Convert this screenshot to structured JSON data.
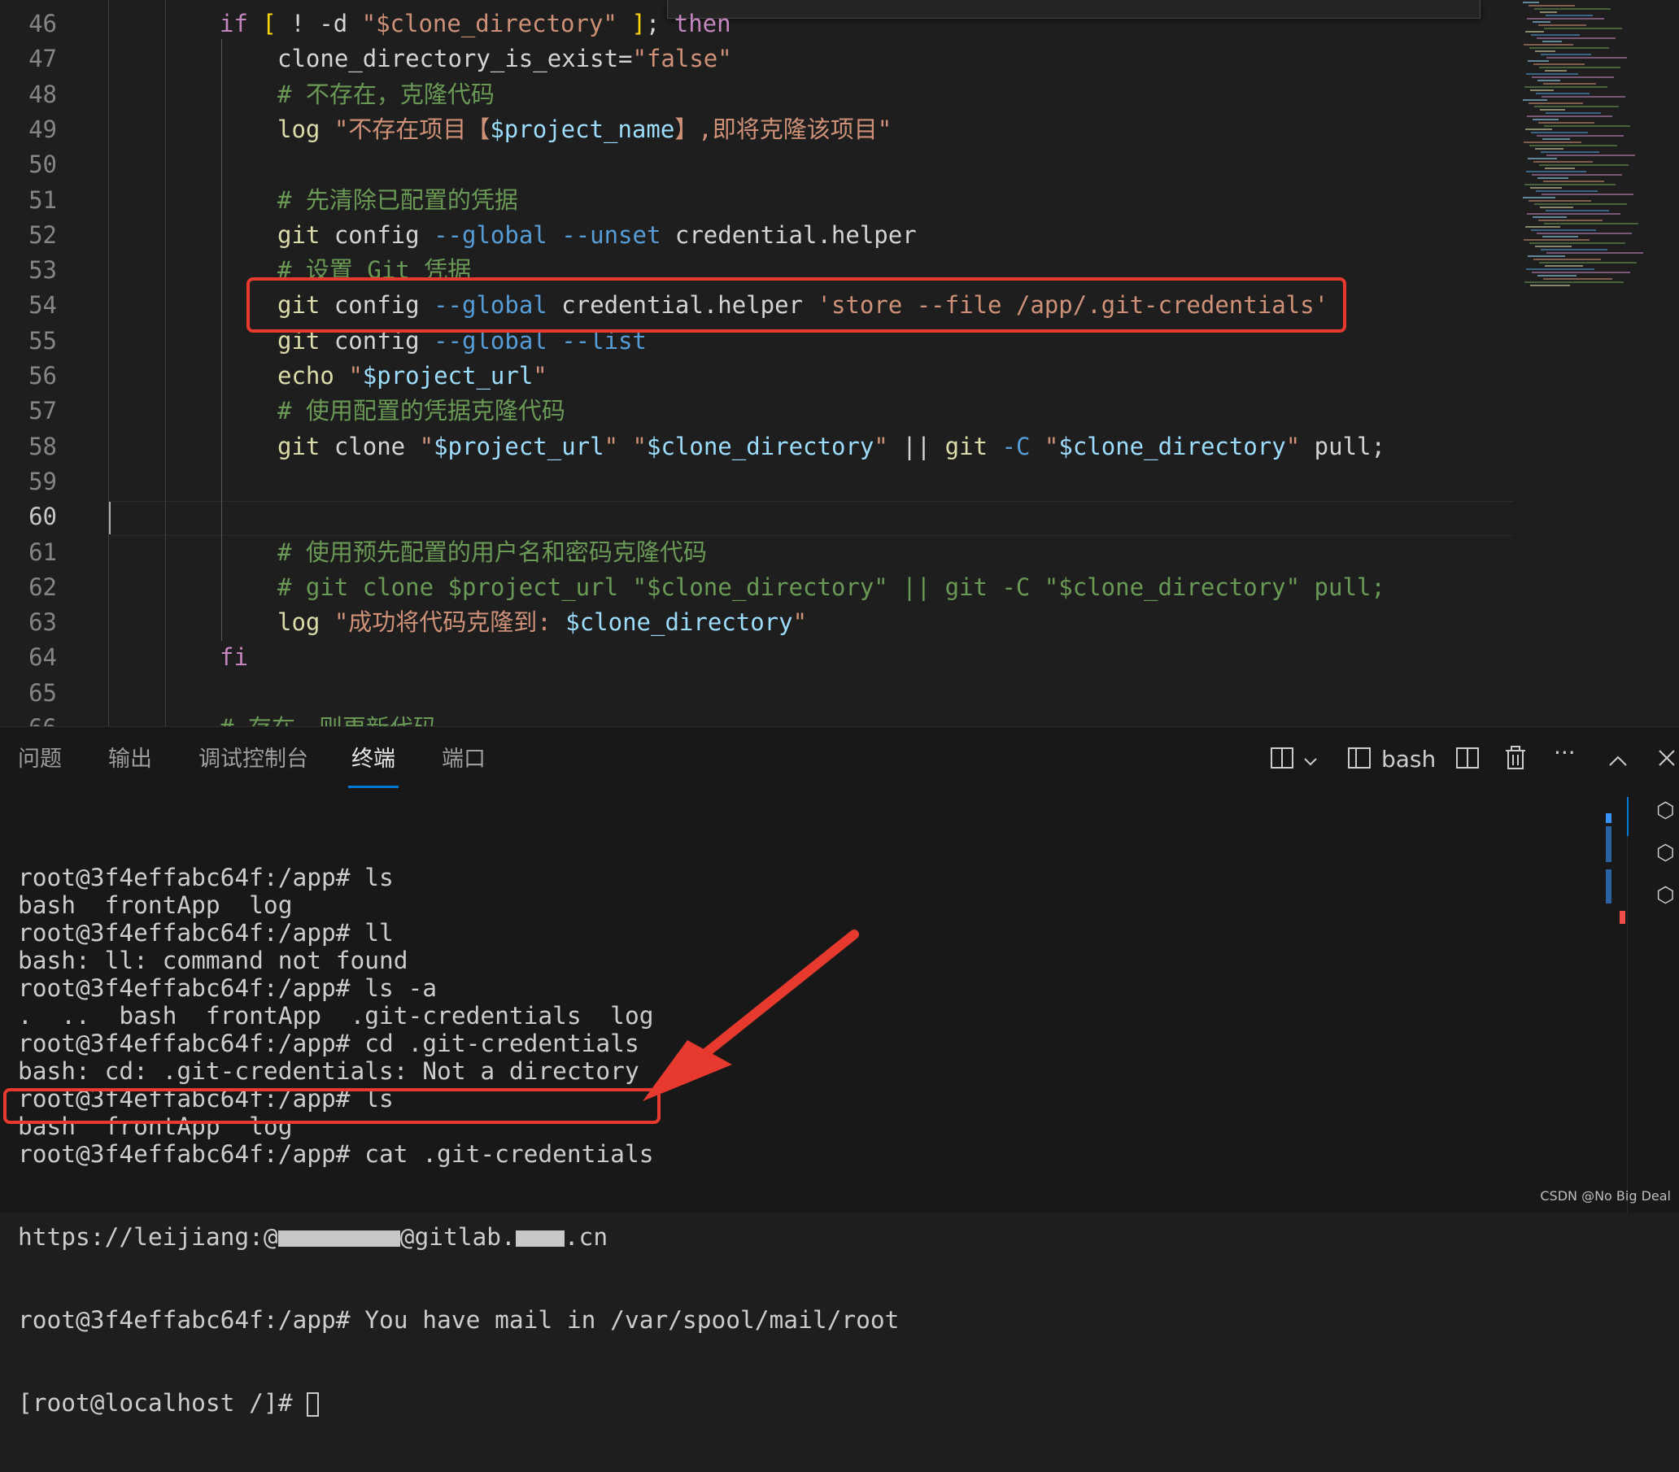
{
  "editor": {
    "find_widget_text": "",
    "current_line": "60",
    "lines": [
      {
        "n": "46",
        "parts": [
          [
            "kw",
            "if "
          ],
          [
            "brk",
            "[ "
          ],
          [
            "op",
            "! -d "
          ],
          [
            "str",
            "\"$clone_directory\""
          ],
          [
            "op",
            " "
          ],
          [
            "brk",
            "]"
          ],
          [
            "op",
            "; "
          ],
          [
            "kw",
            "then"
          ]
        ],
        "indent": 0
      },
      {
        "n": "47",
        "parts": [
          [
            "plain",
            "clone_directory_is_exist"
          ],
          [
            "op",
            "="
          ],
          [
            "str",
            "\"false\""
          ]
        ],
        "indent": 1
      },
      {
        "n": "48",
        "parts": [
          [
            "cm",
            "# 不存在，克隆代码"
          ]
        ],
        "indent": 1
      },
      {
        "n": "49",
        "parts": [
          [
            "fn",
            "log "
          ],
          [
            "str",
            "\"不存在项目【"
          ],
          [
            "var",
            "$project_name"
          ],
          [
            "str",
            "】,即将克隆该项目\""
          ]
        ],
        "indent": 1
      },
      {
        "n": "50",
        "parts": [],
        "indent": 1
      },
      {
        "n": "51",
        "parts": [
          [
            "cm",
            "# 先清除已配置的凭据"
          ]
        ],
        "indent": 1
      },
      {
        "n": "52",
        "parts": [
          [
            "fn",
            "git "
          ],
          [
            "plain",
            "config "
          ],
          [
            "flag",
            "--global --unset "
          ],
          [
            "plain",
            "credential.helper"
          ]
        ],
        "indent": 1
      },
      {
        "n": "53",
        "parts": [
          [
            "cm",
            "# 设置 Git 凭据"
          ]
        ],
        "indent": 1
      },
      {
        "n": "54",
        "parts": [
          [
            "fn",
            "git "
          ],
          [
            "plain",
            "config "
          ],
          [
            "flag",
            "--global "
          ],
          [
            "plain",
            "credential.helper "
          ],
          [
            "str",
            "'store --file /app/.git-credentials'"
          ]
        ],
        "indent": 1
      },
      {
        "n": "55",
        "parts": [
          [
            "fn",
            "git "
          ],
          [
            "plain",
            "config "
          ],
          [
            "flag",
            "--global --list"
          ]
        ],
        "indent": 1
      },
      {
        "n": "56",
        "parts": [
          [
            "fn",
            "echo "
          ],
          [
            "str",
            "\""
          ],
          [
            "var",
            "$project_url"
          ],
          [
            "str",
            "\""
          ]
        ],
        "indent": 1
      },
      {
        "n": "57",
        "parts": [
          [
            "cm",
            "# 使用配置的凭据克隆代码"
          ]
        ],
        "indent": 1
      },
      {
        "n": "58",
        "parts": [
          [
            "fn",
            "git "
          ],
          [
            "plain",
            "clone "
          ],
          [
            "str",
            "\""
          ],
          [
            "var",
            "$project_url"
          ],
          [
            "str",
            "\" \""
          ],
          [
            "var",
            "$clone_directory"
          ],
          [
            "str",
            "\""
          ],
          [
            "op",
            " || "
          ],
          [
            "fn",
            "git "
          ],
          [
            "flag",
            "-C "
          ],
          [
            "str",
            "\""
          ],
          [
            "var",
            "$clone_directory"
          ],
          [
            "str",
            "\""
          ],
          [
            "plain",
            " pull;"
          ]
        ],
        "indent": 1
      },
      {
        "n": "59",
        "parts": [],
        "indent": 1
      },
      {
        "n": "60",
        "parts": [],
        "indent": 1
      },
      {
        "n": "61",
        "parts": [
          [
            "cm",
            "# 使用预先配置的用户名和密码克隆代码"
          ]
        ],
        "indent": 1
      },
      {
        "n": "62",
        "parts": [
          [
            "cm",
            "# git clone $project_url \"$clone_directory\" || git -C \"$clone_directory\" pull;"
          ]
        ],
        "indent": 1
      },
      {
        "n": "63",
        "parts": [
          [
            "fn",
            "log "
          ],
          [
            "str",
            "\"成功将代码克隆到: "
          ],
          [
            "var",
            "$clone_directory"
          ],
          [
            "str",
            "\""
          ]
        ],
        "indent": 1
      },
      {
        "n": "64",
        "parts": [
          [
            "kw",
            "fi"
          ]
        ],
        "indent": 0
      },
      {
        "n": "65",
        "parts": [],
        "indent": 0
      },
      {
        "n": "66",
        "parts": [
          [
            "cm",
            "# 存在，则更新代码"
          ]
        ],
        "indent": 0
      }
    ]
  },
  "panel": {
    "tabs": [
      "问题",
      "输出",
      "调试控制台",
      "终端",
      "端口"
    ],
    "active_tab": "终端",
    "shell_label": "bash",
    "terminal_lines": [
      "root@3f4effabc64f:/app# ls",
      "bash  frontApp  log",
      "root@3f4effabc64f:/app# ll",
      "bash: ll: command not found",
      "root@3f4effabc64f:/app# ls -a",
      ".  ..  bash  frontApp  .git-credentials  log",
      "root@3f4effabc64f:/app# cd .git-credentials",
      "bash: cd: .git-credentials: Not a directory",
      "root@3f4effabc64f:/app# ls",
      "bash  frontApp  log",
      "root@3f4effabc64f:/app# cat .git-credentials"
    ],
    "cred_prefix": "https://leijiang:@",
    "cred_mid": "@gitlab.",
    "cred_suffix": ".cn",
    "mail_line": "root@3f4effabc64f:/app# You have mail in /var/spool/mail/root",
    "prompt_line": "[root@localhost /]# "
  },
  "watermark": "CSDN @No Big Deal",
  "colors": {
    "accent": "#0078d4",
    "highlight": "#e8392f"
  }
}
